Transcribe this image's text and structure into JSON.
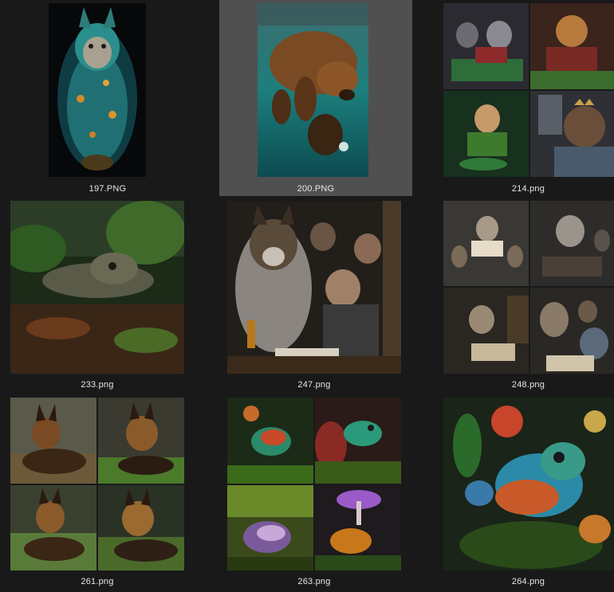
{
  "files": [
    {
      "name": "197.PNG"
    },
    {
      "name": "200.PNG",
      "selected": true
    },
    {
      "name": "214.png"
    },
    {
      "name": "233.png"
    },
    {
      "name": "247.png"
    },
    {
      "name": "248.png"
    },
    {
      "name": "261.png"
    },
    {
      "name": "263.png"
    },
    {
      "name": "264.png"
    }
  ]
}
